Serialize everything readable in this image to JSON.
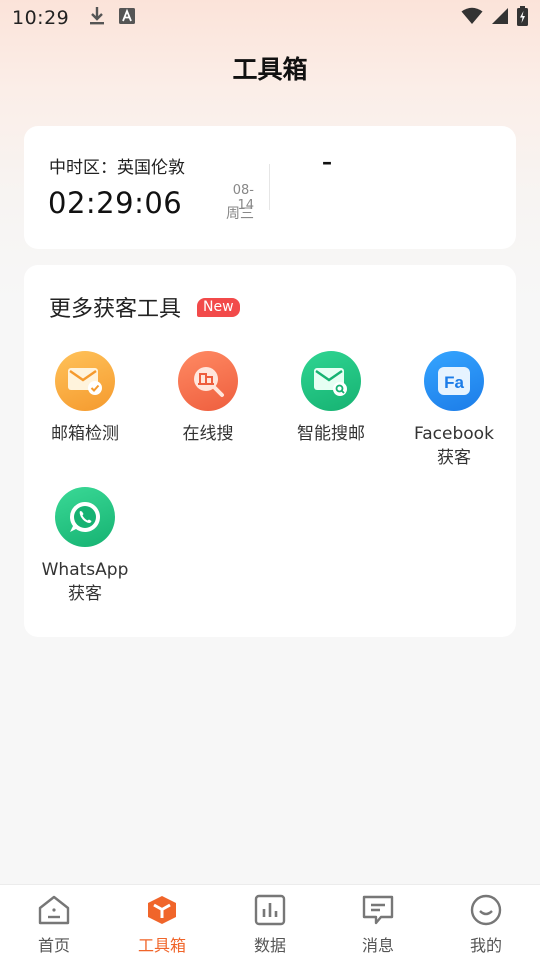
{
  "status_bar": {
    "time": "10:29",
    "icons": [
      "download-icon",
      "a-icon",
      "wifi-icon",
      "signal-icon",
      "battery-icon"
    ]
  },
  "header": {
    "title": "工具箱"
  },
  "clock_card": {
    "timezone_label": "中时区：英国伦敦",
    "time": "02:29:06",
    "date": "08-14",
    "weekday": "周三",
    "second_slot": "–"
  },
  "tools_card": {
    "title": "更多获客工具",
    "badge": "New",
    "tools": [
      {
        "label": "邮箱检测",
        "icon": "mail-check-icon",
        "color": "#f8a93e"
      },
      {
        "label": "在线搜",
        "icon": "search-building-icon",
        "color": "#f27150"
      },
      {
        "label": "智能搜邮",
        "icon": "mail-search-icon",
        "color": "#20c27f"
      },
      {
        "label": "Facebook\n获客",
        "line1": "Facebook",
        "line2": "获客",
        "icon": "facebook-icon",
        "color": "#2a8cf0"
      },
      {
        "label": "WhatsApp\n获客",
        "line1": "WhatsApp",
        "line2": "获客",
        "icon": "whatsapp-icon",
        "color": "#21c17c"
      }
    ]
  },
  "tab_bar": {
    "active": 1,
    "items": [
      {
        "label": "首页",
        "icon": "home-icon"
      },
      {
        "label": "工具箱",
        "icon": "toolbox-icon"
      },
      {
        "label": "数据",
        "icon": "chart-icon"
      },
      {
        "label": "消息",
        "icon": "message-icon"
      },
      {
        "label": "我的",
        "icon": "profile-icon"
      }
    ]
  },
  "colors": {
    "accent": "#f0652a",
    "badge": "#f24a4a",
    "background": "#f7f7f7"
  }
}
